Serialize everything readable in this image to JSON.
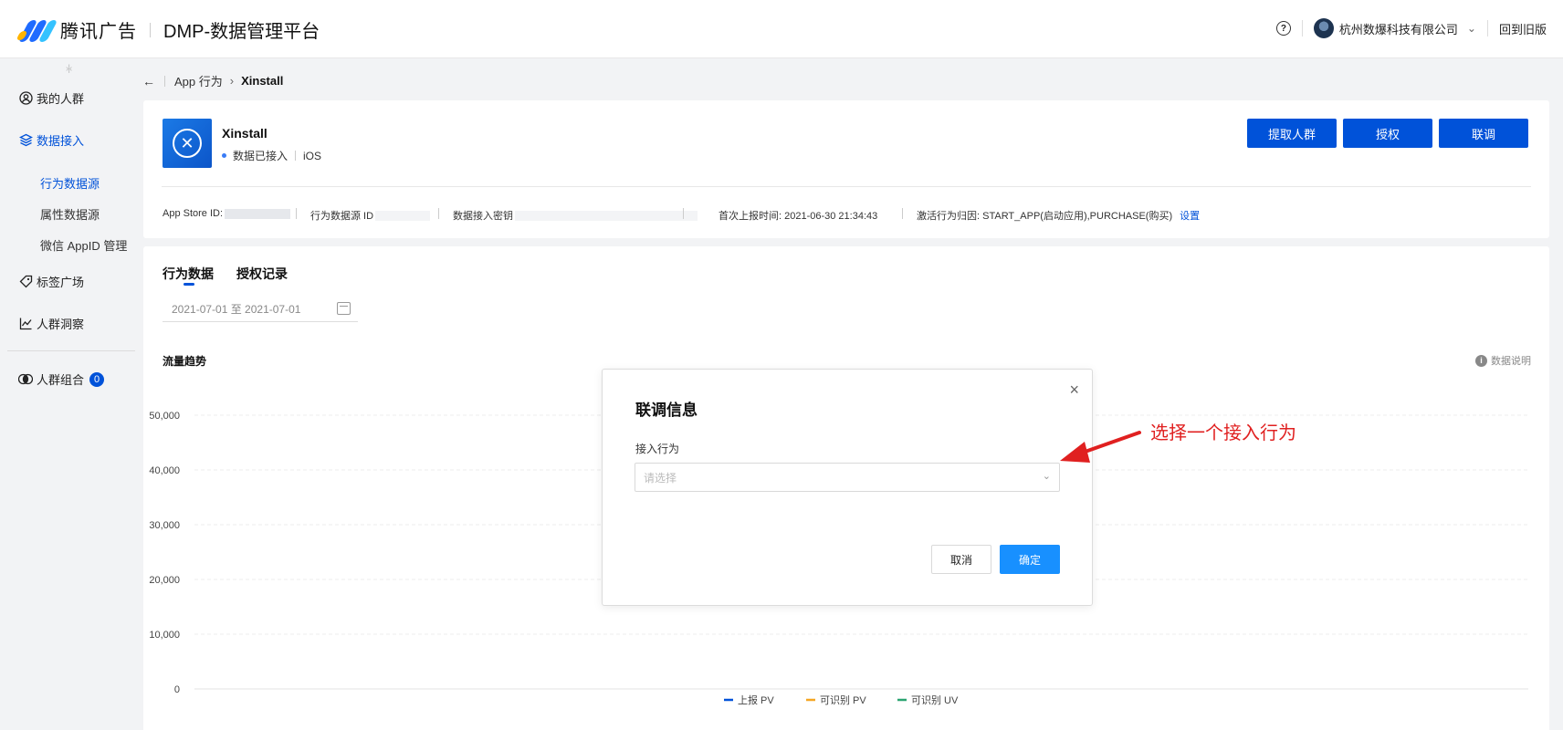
{
  "header": {
    "brand": "腾讯广告",
    "product": "DMP-数据管理平台",
    "help_icon": "question-circle-icon",
    "company": "杭州数爆科技有限公司",
    "back_old": "回到旧版"
  },
  "sidebar": {
    "collapse_handle": "›|‹",
    "items": [
      {
        "label": "我的人群",
        "icon": "user-circle-icon"
      },
      {
        "label": "数据接入",
        "icon": "layers-icon"
      },
      {
        "label": "标签广场",
        "icon": "tag-icon"
      },
      {
        "label": "人群洞察",
        "icon": "line-chart-icon"
      },
      {
        "label": "人群组合",
        "icon": "venn-icon",
        "badge": "0"
      }
    ],
    "sub_items": [
      "行为数据源",
      "属性数据源",
      "微信 AppID 管理"
    ]
  },
  "breadcrumb": {
    "back": "←",
    "parent": "App 行为",
    "separator": "›",
    "current": "Xinstall"
  },
  "app": {
    "name": "Xinstall",
    "status": "数据已接入",
    "platform": "iOS",
    "logo_glyph": "✕",
    "buttons": [
      "提取人群",
      "授权",
      "联调"
    ],
    "meta": {
      "app_store_id_label": "App Store ID:",
      "source_id_label": "行为数据源 ID",
      "secret_label": "数据接入密钥",
      "first_report": "首次上报时间: 2021-06-30 21:34:43",
      "attribution": "激活行为归因: START_APP(启动应用),PURCHASE(购买)",
      "settings_link": "设置"
    }
  },
  "tabs": [
    "行为数据",
    "授权记录"
  ],
  "date_range": "2021-07-01 至 2021-07-01",
  "section_title": "流量趋势",
  "data_desc": "数据说明",
  "chart_data": {
    "type": "line",
    "title": "流量趋势",
    "ylim": [
      0,
      50000
    ],
    "yticks": [
      "50,000",
      "40,000",
      "30,000",
      "20,000",
      "10,000",
      "0"
    ],
    "grid": true,
    "legend_placement": "bottom",
    "series": [
      {
        "name": "上报 PV",
        "color": "#0052d9",
        "values": []
      },
      {
        "name": "可识别 PV",
        "color": "#f5a623",
        "values": []
      },
      {
        "name": "可识别 UV",
        "color": "#2ba471",
        "values": []
      }
    ]
  },
  "modal": {
    "title": "联调信息",
    "close": "×",
    "field_label": "接入行为",
    "select_placeholder": "请选择",
    "cancel": "取消",
    "ok": "确定"
  },
  "annotation": {
    "text": "选择一个接入行为",
    "color": "#e02020"
  }
}
